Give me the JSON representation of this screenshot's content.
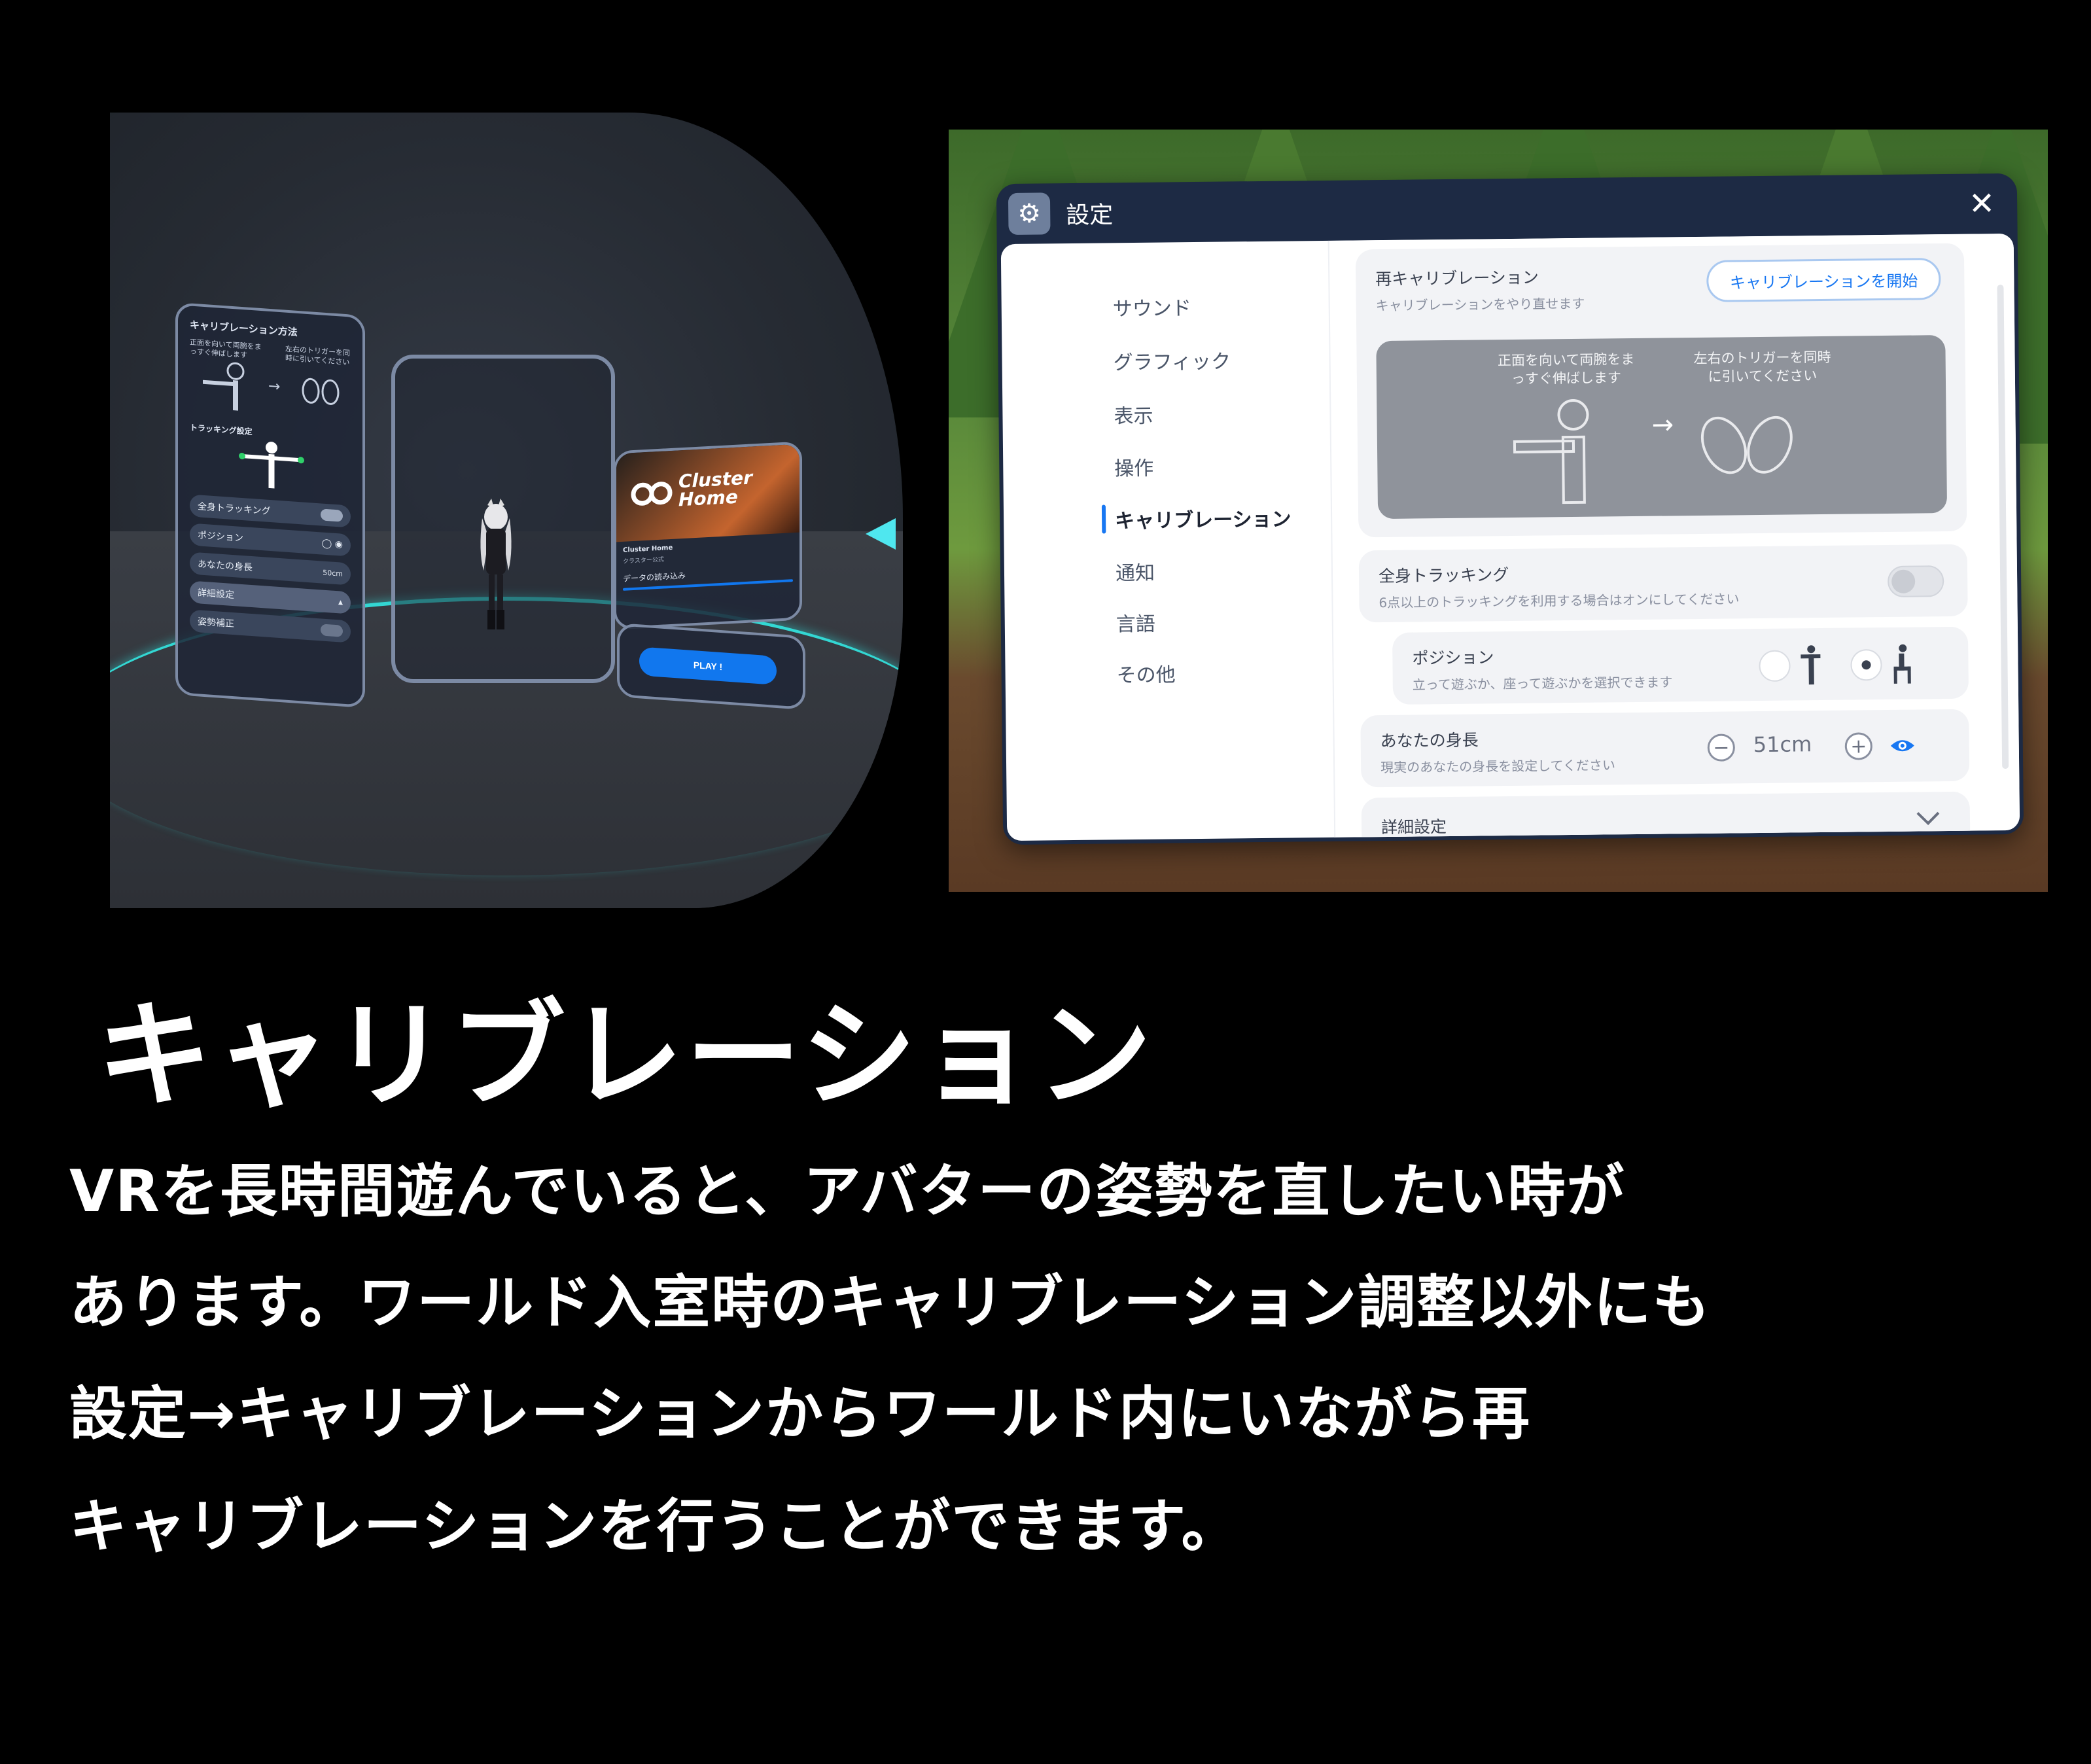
{
  "vr_lobby": {
    "calibration_panel": {
      "title": "キャリブレーション方法",
      "instruction_left": "正面を向いて両腕をまっすぐ伸ばします",
      "instruction_right": "左右のトリガーを同時に引いてください",
      "tracking_heading": "トラッキング設定",
      "full_body_label": "全身トラッキング",
      "position_label": "ポジション",
      "height_label": "あなたの身長",
      "height_value": "50cm",
      "advanced_label": "詳細設定",
      "posture_label": "姿勢補正"
    },
    "home_card": {
      "title_line1": "Cluster",
      "title_line2": "Home",
      "world_name": "Cluster Home",
      "owner": "クラスター公式",
      "loading_text": "データの読み込み",
      "play_label": "PLAY !"
    }
  },
  "settings": {
    "title": "設定",
    "close_glyph": "✕",
    "nav": [
      "サウンド",
      "グラフィック",
      "表示",
      "操作",
      "キャリブレーション",
      "通知",
      "言語",
      "その他"
    ],
    "active_nav": "キャリブレーション",
    "recalibration": {
      "title": "再キャリブレーション",
      "subtitle": "キャリブレーションをやり直せます",
      "button": "キャリブレーションを開始",
      "step1": "正面を向いて両腕をま\nっすぐ伸ばします",
      "step2": "左右のトリガーを同時\nに引いてください"
    },
    "full_body": {
      "title": "全身トラッキング",
      "subtitle": "6点以上のトラッキングを利用する場合はオンにしてください",
      "enabled": false
    },
    "position": {
      "title": "ポジション",
      "subtitle": "立って遊ぶか、座って遊ぶかを選択できます",
      "selected": "sitting"
    },
    "height": {
      "title": "あなたの身長",
      "subtitle": "現実のあなたの身長を設定してください",
      "value": "51cm",
      "minus": "−",
      "plus": "+"
    },
    "advanced": {
      "title": "詳細設定"
    }
  },
  "article": {
    "heading": "キャリブレーション",
    "lines": [
      "VRを長時間遊んでいると、アバターの姿勢を直したい時が",
      "あります。ワールド入室時のキャリブレーション調整以外にも",
      "設定→キャリブレーションからワールド内にいながら再",
      "キャリブレーションを行うことができます。"
    ]
  },
  "colors": {
    "accent": "#1877f2",
    "ring": "#33d7d3",
    "window_header": "#1d2a44"
  }
}
